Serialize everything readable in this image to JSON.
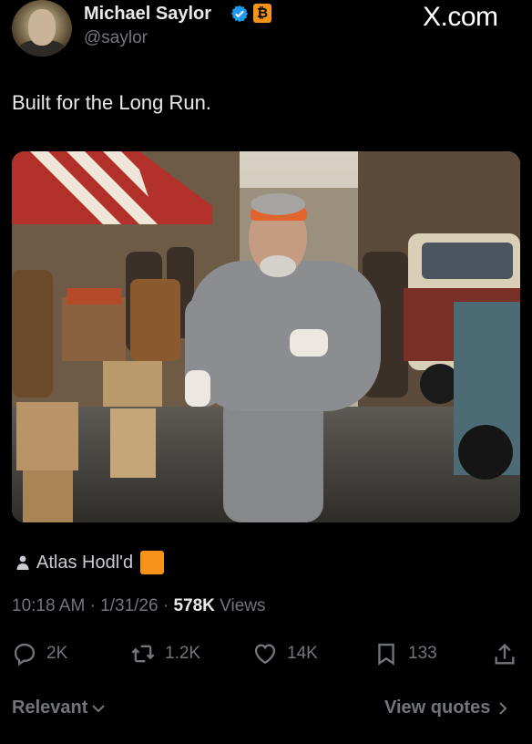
{
  "header": {
    "name": "Michael Saylor",
    "handle": "@saylor",
    "badge": "₿",
    "watermark": "X.com"
  },
  "tweet": {
    "text": "Built for the Long Run."
  },
  "image_credit": {
    "label": "Atlas Hodl'd"
  },
  "meta": {
    "time": "10:18 AM",
    "date": "1/31/26",
    "views_count": "578K",
    "views_label": "Views"
  },
  "actions": {
    "replies": "2K",
    "reposts": "1.2K",
    "likes": "14K",
    "bookmarks": "133"
  },
  "footer": {
    "sort_label": "Relevant",
    "view_quotes": "View quotes"
  },
  "colors": {
    "text": "#e7e9ea",
    "muted": "#71767b",
    "verified": "#1d9bf0",
    "bitcoin": "#f7931a",
    "background": "#000000"
  },
  "icons": [
    "verified-icon",
    "reply-icon",
    "repost-icon",
    "like-icon",
    "bookmark-icon",
    "share-icon",
    "person-icon",
    "chevron-down-icon",
    "chevron-right-icon"
  ]
}
